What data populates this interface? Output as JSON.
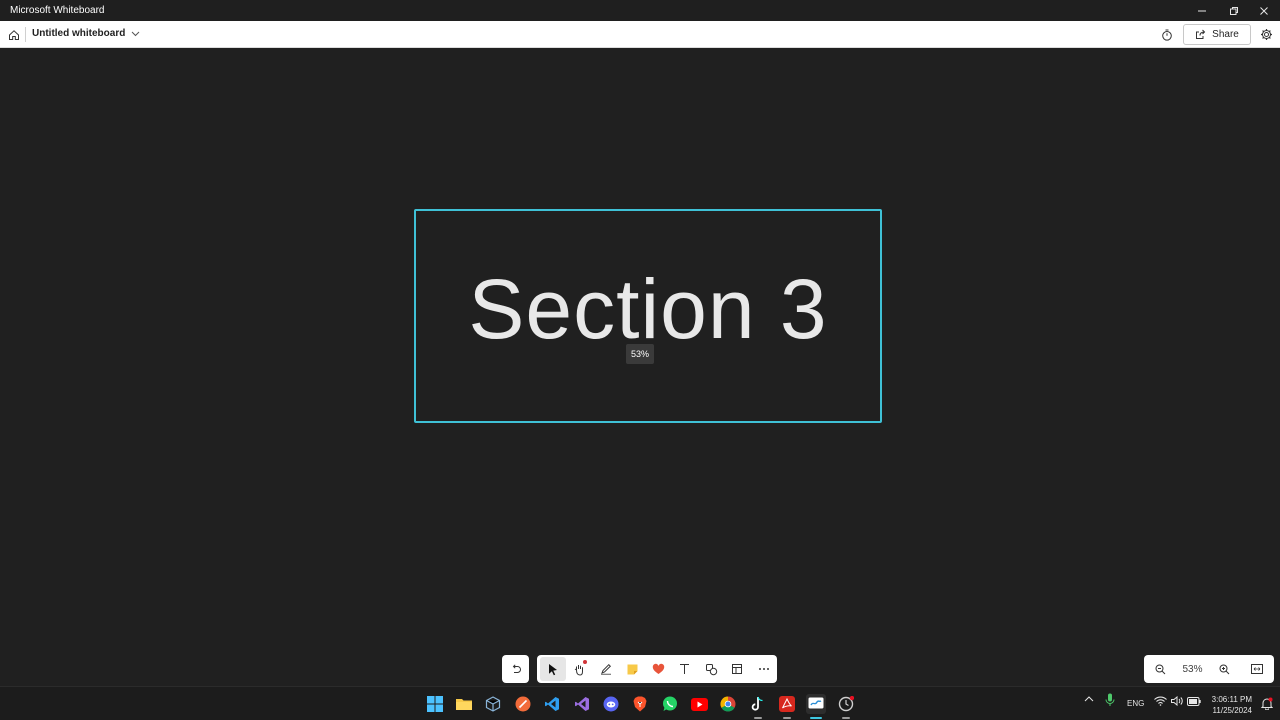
{
  "window": {
    "title": "Microsoft Whiteboard"
  },
  "header": {
    "board_title": "Untitled whiteboard",
    "share_label": "Share",
    "home_icon": "home-icon",
    "timer_icon": "timer-icon",
    "settings_icon": "gear-icon"
  },
  "canvas": {
    "section_text": "Section 3",
    "section_border_color": "#3fc1d6",
    "zoom_tooltip": "53%"
  },
  "toolbar": {
    "tools": [
      "select",
      "pan",
      "pen",
      "sticky-note",
      "reaction",
      "text",
      "shapes",
      "templates",
      "more"
    ],
    "active_tool": "select"
  },
  "zoom": {
    "level": "53%"
  },
  "taskbar": {
    "apps": [
      "start",
      "file-explorer",
      "virtualbox",
      "app-orange",
      "vscode",
      "visual-studio",
      "discord",
      "brave",
      "whatsapp",
      "youtube",
      "chrome",
      "tiktok",
      "acrobat",
      "whiteboard",
      "app-clock"
    ],
    "active_app": "whiteboard",
    "language": "ENG",
    "time": "3:06:11 PM",
    "date": "11/25/2024"
  }
}
